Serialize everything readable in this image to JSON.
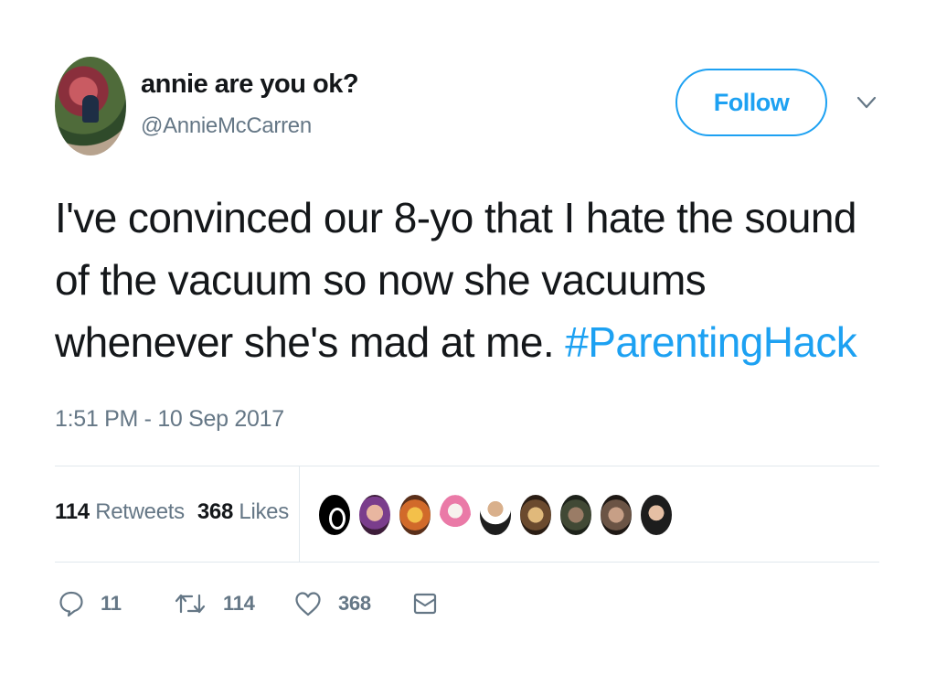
{
  "author": {
    "display_name": "annie are you ok?",
    "handle": "@AnnieMcCarren"
  },
  "follow_button_label": "Follow",
  "tweet": {
    "text": "I've convinced our 8-yo that I hate the sound of the vacuum so now she vacuums whenever she's mad at me.",
    "hashtag": "#ParentingHack",
    "timestamp": "1:51 PM - 10 Sep 2017"
  },
  "stats": {
    "retweets_count": "114",
    "retweets_label": "Retweets",
    "likes_count": "368",
    "likes_label": "Likes"
  },
  "liker_avatars": [
    "avatar",
    "avatar",
    "avatar",
    "avatar",
    "avatar",
    "avatar",
    "avatar",
    "avatar",
    "avatar"
  ],
  "actions": {
    "reply_count": "11",
    "retweet_count": "114",
    "like_count": "368"
  },
  "colors": {
    "accent": "#1da1f2",
    "secondary_text": "#657786",
    "primary_text": "#14171a",
    "divider": "#e1e8ed"
  },
  "icons": [
    "chevron-down-icon",
    "reply-icon",
    "retweet-icon",
    "heart-icon",
    "message-icon"
  ]
}
